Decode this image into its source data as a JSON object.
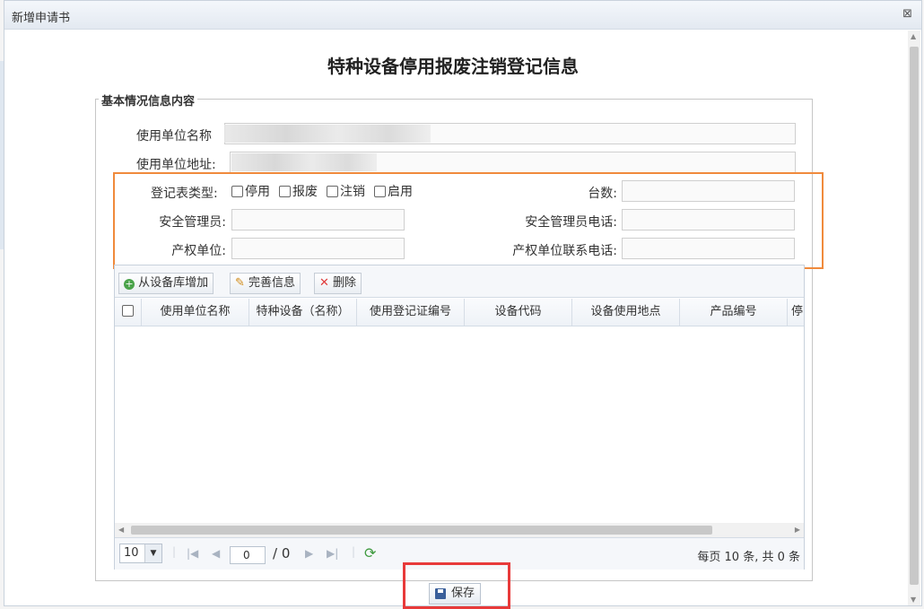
{
  "window": {
    "title": "新增申请书",
    "close_symbol": "⊠"
  },
  "form": {
    "title": "特种设备停用报废注销登记信息",
    "legend": "基本情况信息内容",
    "fields": {
      "unit_name_label": "使用单位名称",
      "unit_address_label": "使用单位地址:",
      "reg_type_label": "登记表类型:",
      "count_label": "台数:",
      "safety_manager_label": "安全管理员:",
      "safety_manager_phone_label": "安全管理员电话:",
      "property_unit_label": "产权单位:",
      "property_unit_phone_label": "产权单位联系电话:"
    },
    "reg_types": [
      "停用",
      "报废",
      "注销",
      "启用"
    ]
  },
  "toolbar": {
    "add_from_library": "从设备库增加",
    "complete_info": "完善信息",
    "delete": "删除"
  },
  "grid": {
    "columns": [
      "使用单位名称",
      "特种设备（名称）",
      "使用登记证编号",
      "设备代码",
      "设备使用地点",
      "产品编号",
      "停"
    ]
  },
  "pager": {
    "page_size": "10",
    "current_page": "0",
    "total_pages": "/ 0",
    "summary": "每页 10 条, 共 0 条"
  },
  "actions": {
    "save": "保存"
  },
  "colors": {
    "highlight_orange": "#f08a3c",
    "highlight_red": "#e83a3a"
  }
}
